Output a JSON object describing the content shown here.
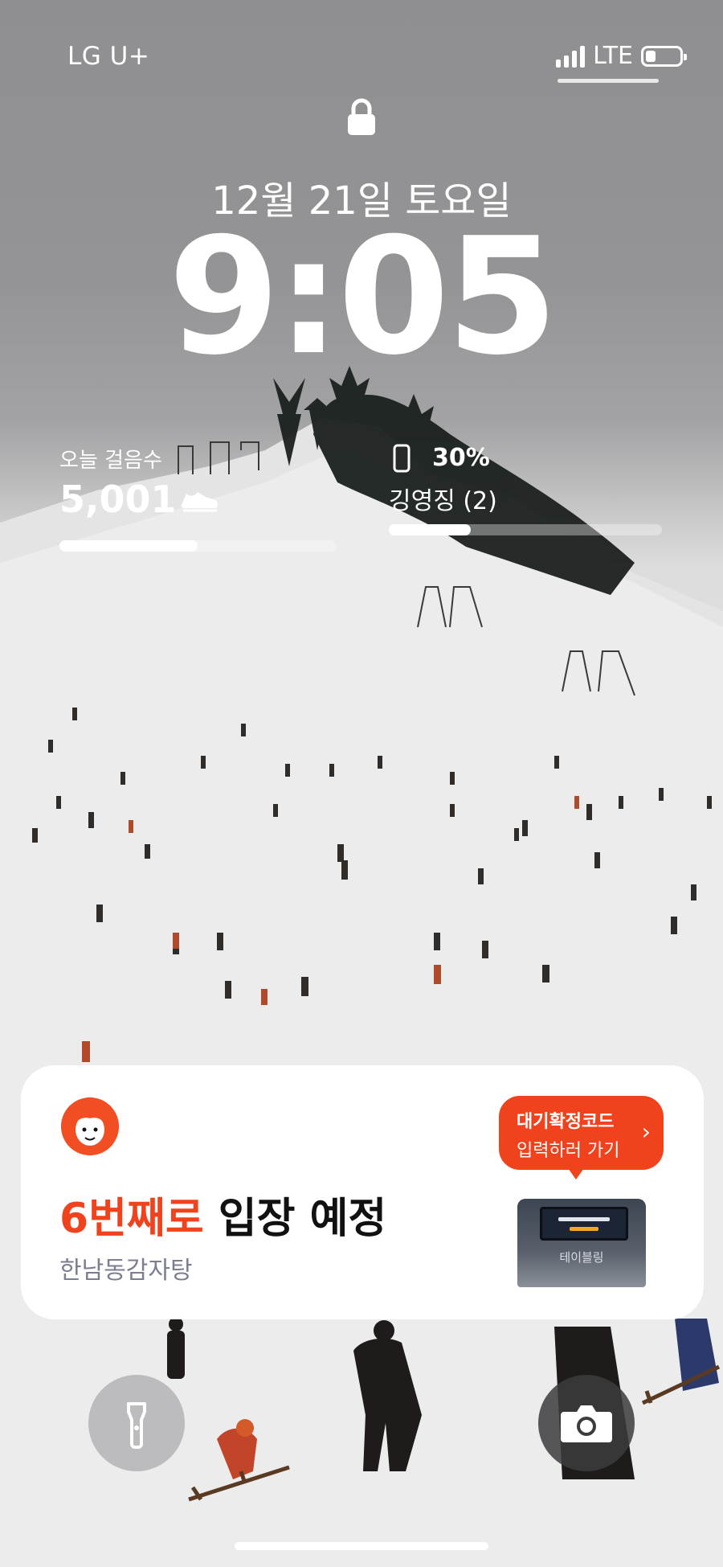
{
  "status_bar": {
    "carrier": "LG U+",
    "network": "LTE",
    "signal_bars": 4,
    "battery_level_fraction": 0.3
  },
  "lock_screen": {
    "date": "12월 21일 토요일",
    "time": "9:05"
  },
  "widgets": {
    "steps": {
      "label": "오늘 걸음수",
      "value": "5,001",
      "progress_fraction": 0.5,
      "icon": "shoe-icon"
    },
    "battery": {
      "percent": "30%",
      "device_name": "깅영징 (2)",
      "progress_fraction": 0.3,
      "icon": "phone-icon"
    }
  },
  "notification": {
    "title_highlight": "6번째로",
    "title_rest": " 입장 예정",
    "subtitle": "한남동감자탕",
    "cta_line1": "대기확정코드",
    "cta_line2": "입력하러 가기",
    "cta_chevron": "›",
    "device_brand": "테이블링",
    "accent_color": "#f0421d"
  },
  "buttons": {
    "flashlight": "flashlight-icon",
    "camera": "camera-icon"
  }
}
